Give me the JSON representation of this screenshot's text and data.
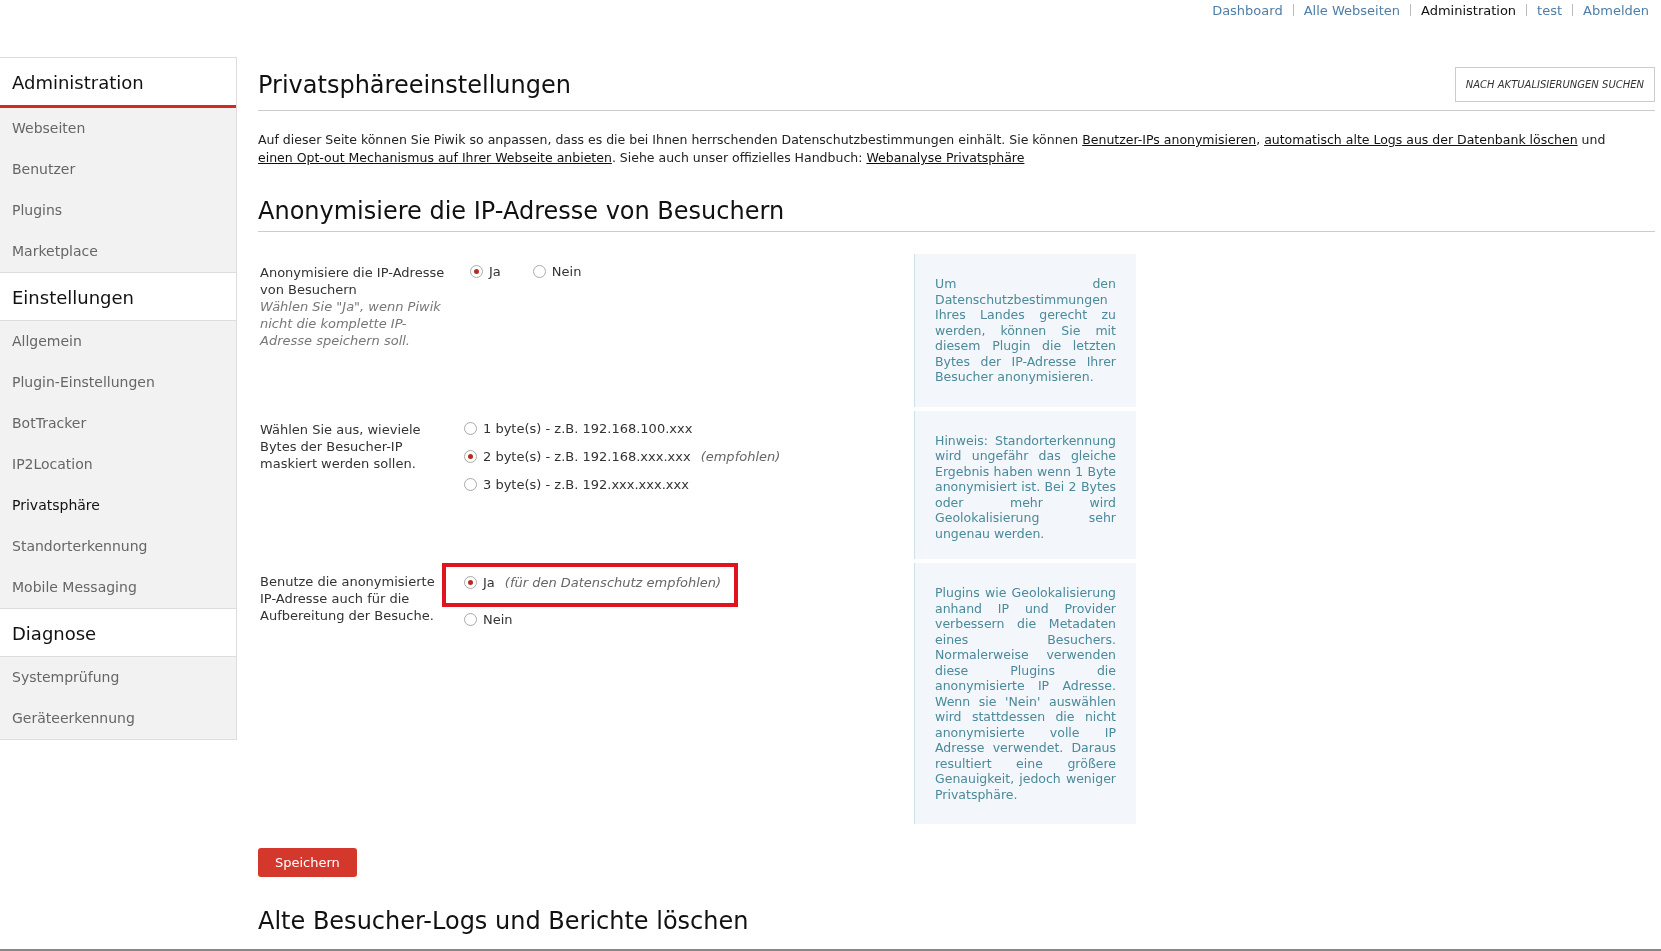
{
  "top_nav": [
    {
      "label": "Dashboard",
      "selected": false
    },
    {
      "label": "Alle Webseiten",
      "selected": false
    },
    {
      "label": "Administration",
      "selected": true
    },
    {
      "label": "test",
      "selected": false
    },
    {
      "label": "Abmelden",
      "selected": false
    }
  ],
  "sidebar": [
    {
      "heading": "Administration",
      "active": true,
      "items": [
        {
          "label": "Webseiten",
          "selected": false
        },
        {
          "label": "Benutzer",
          "selected": false
        },
        {
          "label": "Plugins",
          "selected": false
        },
        {
          "label": "Marketplace",
          "selected": false
        }
      ]
    },
    {
      "heading": "Einstellungen",
      "active": false,
      "items": [
        {
          "label": "Allgemein",
          "selected": false
        },
        {
          "label": "Plugin-Einstellungen",
          "selected": false
        },
        {
          "label": "BotTracker",
          "selected": false
        },
        {
          "label": "IP2Location",
          "selected": false
        },
        {
          "label": "Privatsphäre",
          "selected": true
        },
        {
          "label": "Standorterkennung",
          "selected": false
        },
        {
          "label": "Mobile Messaging",
          "selected": false
        }
      ]
    },
    {
      "heading": "Diagnose",
      "active": false,
      "items": [
        {
          "label": "Systemprüfung",
          "selected": false
        },
        {
          "label": "Geräteerkennung",
          "selected": false
        }
      ]
    }
  ],
  "page_title": "Privatsphäreeinstellungen",
  "update_button": "NACH AKTUALISIERUNGEN SUCHEN",
  "intro": [
    {
      "kind": "text",
      "text": "Auf dieser Seite können Sie Piwik so anpassen, dass es die bei Ihnen herrschenden Datenschutzbestimmungen einhält. Sie können "
    },
    {
      "kind": "link",
      "text": "Benutzer-IPs anonymisieren"
    },
    {
      "kind": "text",
      "text": ", "
    },
    {
      "kind": "link",
      "text": "automatisch alte Logs aus der Datenbank löschen"
    },
    {
      "kind": "text",
      "text": " und "
    },
    {
      "kind": "link",
      "text": "einen Opt-out Mechanismus auf Ihrer Webseite anbieten"
    },
    {
      "kind": "text",
      "text": ". Siehe auch unser offizielles Handbuch: "
    },
    {
      "kind": "link",
      "text": "Webanalyse Privatsphäre"
    }
  ],
  "section_title": "Anonymisiere die IP-Adresse von Besuchern",
  "settings": [
    {
      "label": "Anonymisiere die IP-Adresse von Besuchern",
      "hint": "Wählen Sie \"Ja\", wenn Piwik nicht die komplette IP-Adresse speichern soll.",
      "kind": "inline",
      "highlighted": false,
      "options": [
        {
          "label": "Ja",
          "selected": true
        },
        {
          "label": "Nein",
          "selected": false
        }
      ],
      "help": "Um den Datenschutzbestimmungen Ihres Landes gerecht zu werden, können Sie mit diesem Plugin die letzten Bytes der IP-Adresse Ihrer Besucher anonymisieren."
    },
    {
      "label": "Wählen Sie aus, wieviele Bytes der Besucher-IP maskiert werden sollen.",
      "kind": "stacked",
      "highlighted": false,
      "options": [
        {
          "label": "1 byte(s) - z.B. 192.168.100.xxx",
          "selected": false
        },
        {
          "label": "2 byte(s) - z.B. 192.168.xxx.xxx",
          "note": "(empfohlen)",
          "selected": true
        },
        {
          "label": "3 byte(s) - z.B. 192.xxx.xxx.xxx",
          "selected": false
        }
      ],
      "help": "Hinweis: Standorterkennung wird ungefähr das gleiche Ergebnis haben wenn 1 Byte anonymisiert ist. Bei 2 Bytes oder mehr wird Geolokalisierung sehr ungenau werden."
    },
    {
      "label": "Benutze die anonymisierte IP-Adresse auch für die Aufbereitung der Besuche.",
      "kind": "stacked",
      "highlighted": true,
      "options": [
        {
          "label": "Ja",
          "note": "(für den Datenschutz empfohlen)",
          "selected": true
        },
        {
          "label": "Nein",
          "selected": false
        }
      ],
      "help": "Plugins wie Geolokalisierung anhand IP und Provider verbessern die Metadaten eines Besuchers. Normalerweise verwenden diese Plugins die anonymisierte IP Adresse. Wenn sie 'Nein' auswählen wird stattdessen die nicht anonymisierte volle IP Adresse verwendet. Daraus resultiert eine größere Genauigkeit, jedoch weniger Privatsphäre."
    }
  ],
  "save_button": "Speichern",
  "next_section_title": "Alte Besucher-Logs und Berichte löschen"
}
